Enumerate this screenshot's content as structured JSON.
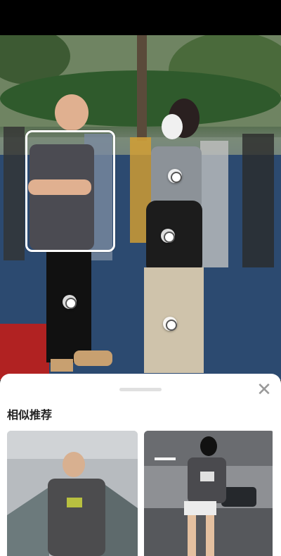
{
  "sheet": {
    "title": "相似推荐",
    "close_icon": "close-icon"
  },
  "photo": {
    "description_icon": "photo"
  },
  "recommendations": [
    {
      "id": 1
    },
    {
      "id": 2
    }
  ]
}
